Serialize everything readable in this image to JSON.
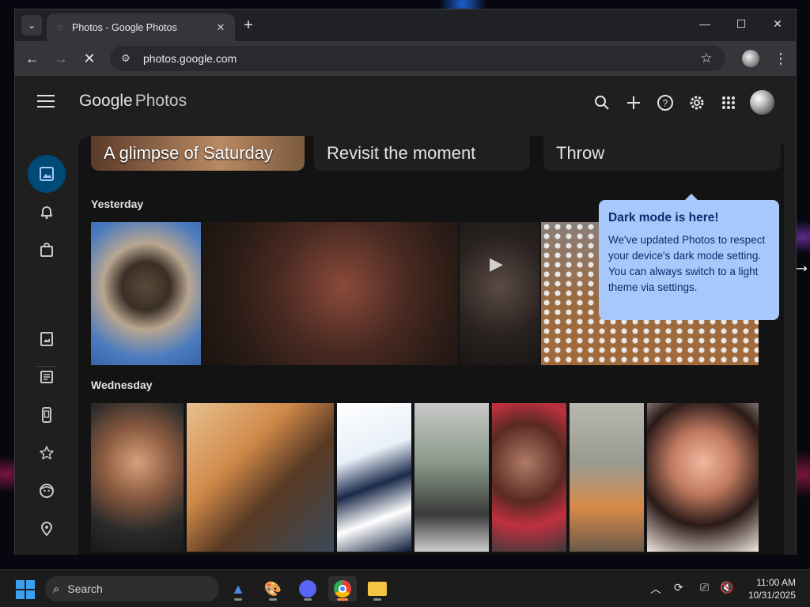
{
  "browser": {
    "tab_title": "Photos - Google Photos",
    "url": "photos.google.com"
  },
  "app": {
    "logo_brand": "Google",
    "logo_product": "Photos"
  },
  "memories": [
    {
      "label": "A glimpse of Saturday"
    },
    {
      "label": "Revisit the moment"
    },
    {
      "label": "Throw"
    }
  ],
  "sections": [
    {
      "title": "Yesterday"
    },
    {
      "title": "Wednesday"
    }
  ],
  "tooltip": {
    "title": "Dark mode is here!",
    "body": "We've updated Photos to respect your device's dark mode setting. You can always switch to a light theme via settings."
  },
  "taskbar": {
    "search_label": "Search",
    "time": "11:00 AM",
    "date": "10/31/2025"
  },
  "colors": {
    "active_nav": "#004a77",
    "tooltip_bg": "#a8c7fa",
    "page_bg": "#1f1f1f"
  }
}
